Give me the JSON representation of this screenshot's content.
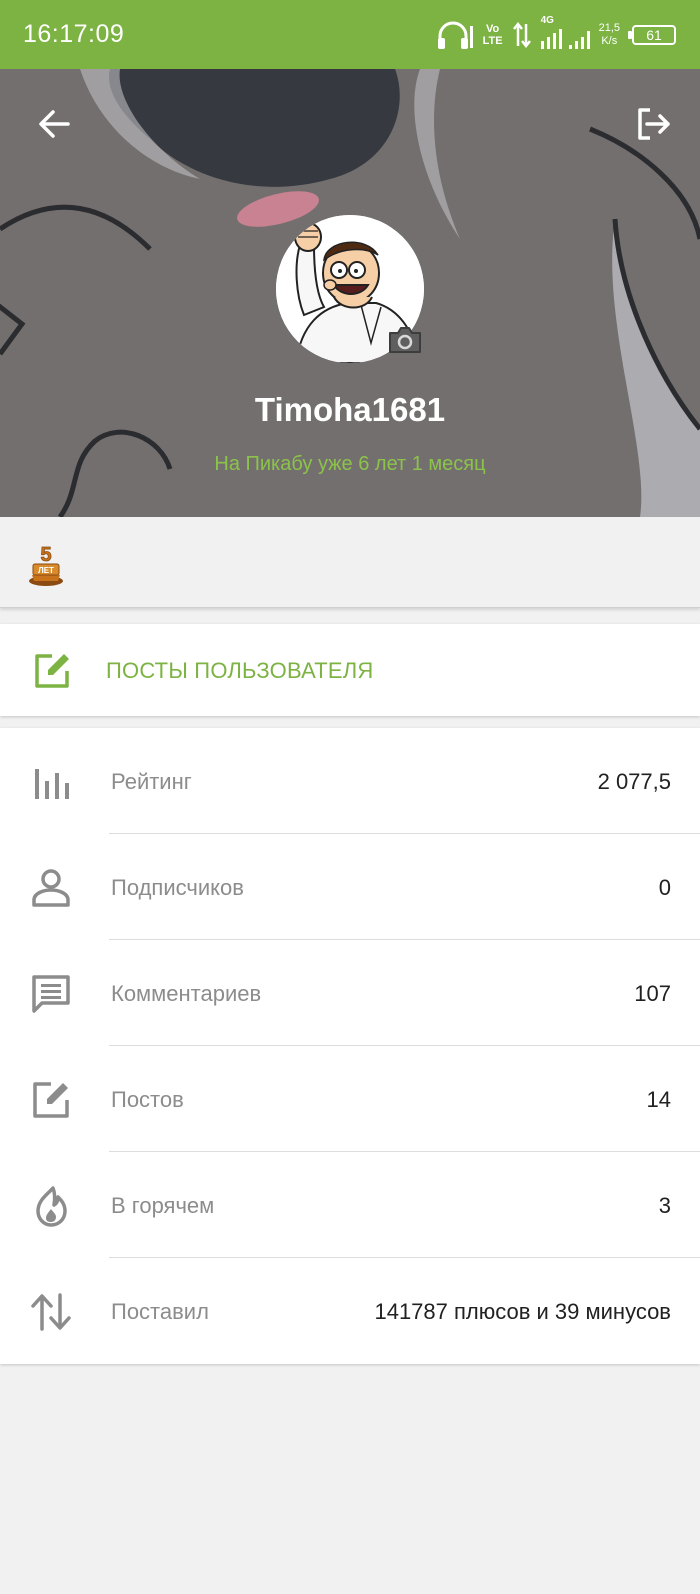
{
  "status_bar": {
    "time": "16:17:09",
    "volte_top": "Vo",
    "volte_bottom": "LTE",
    "network": "4G",
    "speed_value": "21,5",
    "speed_unit": "K/s",
    "battery": "61",
    "icons": [
      "headphones-icon",
      "volte-icon",
      "data-arrows-icon",
      "signal-icon",
      "battery-icon"
    ]
  },
  "header": {
    "username": "Timoha1681",
    "member_since": "На Пикабу уже 6 лет 1 месяц",
    "icons": [
      "back-arrow-icon",
      "logout-icon",
      "camera-icon"
    ]
  },
  "awards": [
    {
      "name": "5-years-award",
      "number": "5",
      "text": "ЛЕТ"
    }
  ],
  "posts_button": {
    "label": "ПОСТЫ ПОЛЬЗОВАТЕЛЯ",
    "icon": "edit-icon"
  },
  "stats": [
    {
      "icon": "rating-icon",
      "label": "Рейтинг",
      "value": "2 077,5"
    },
    {
      "icon": "person-icon",
      "label": "Подписчиков",
      "value": "0"
    },
    {
      "icon": "comments-icon",
      "label": "Комментариев",
      "value": "107"
    },
    {
      "icon": "edit-icon",
      "label": "Постов",
      "value": "14"
    },
    {
      "icon": "flame-icon",
      "label": "В горячем",
      "value": "3"
    },
    {
      "icon": "sort-arrows-icon",
      "label": "Поставил",
      "value": "141787 плюсов и 39 минусов"
    }
  ],
  "colors": {
    "accent": "#7cb342",
    "accent_light": "#8bc34a",
    "text_primary": "#212121",
    "text_secondary": "#8c8c8c",
    "background": "#f1f1f1"
  }
}
